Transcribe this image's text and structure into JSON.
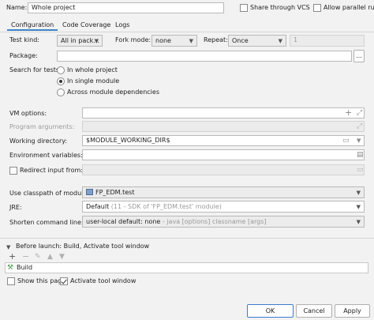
{
  "header": {
    "name_label": "Name:",
    "name_value": "Whole project",
    "share_vcs": "Share through VCS",
    "parallel_run": "Allow parallel run"
  },
  "tabs": [
    {
      "label": "Configuration"
    },
    {
      "label": "Code Coverage"
    },
    {
      "label": "Logs"
    }
  ],
  "form": {
    "test_kind_label": "Test kind:",
    "test_kind_value": "All in pack...",
    "fork_mode_label": "Fork mode:",
    "fork_mode_value": "none",
    "repeat_label": "Repeat:",
    "repeat_value": "Once",
    "repeat_count": "1",
    "package_label": "Package:",
    "browse_label": "...",
    "search_label": "Search for tests:",
    "search_options": [
      "In whole project",
      "In single module",
      "Across module dependencies"
    ],
    "vm_options_label": "VM options:",
    "program_args_label": "Program arguments:",
    "working_dir_label": "Working directory:",
    "working_dir_value": "$MODULE_WORKING_DIR$",
    "env_vars_label": "Environment variables:",
    "redirect_label": "Redirect input from:",
    "classpath_label": "Use classpath of module:",
    "classpath_value": "FP_EDM.test",
    "jre_label": "JRE:",
    "jre_value": "Default",
    "jre_hint": "(11 - SDK of 'FP_EDM.test' module)",
    "shorten_label": "Shorten command line:",
    "shorten_value": "user-local default: none",
    "shorten_hint": "- java [options] classname [args]"
  },
  "before_launch": {
    "title": "Before launch: Build, Activate tool window",
    "item": "Build",
    "show_page": "Show this page",
    "activate_window": "Activate tool window"
  },
  "buttons": {
    "ok": "OK",
    "cancel": "Cancel",
    "apply": "Apply"
  }
}
